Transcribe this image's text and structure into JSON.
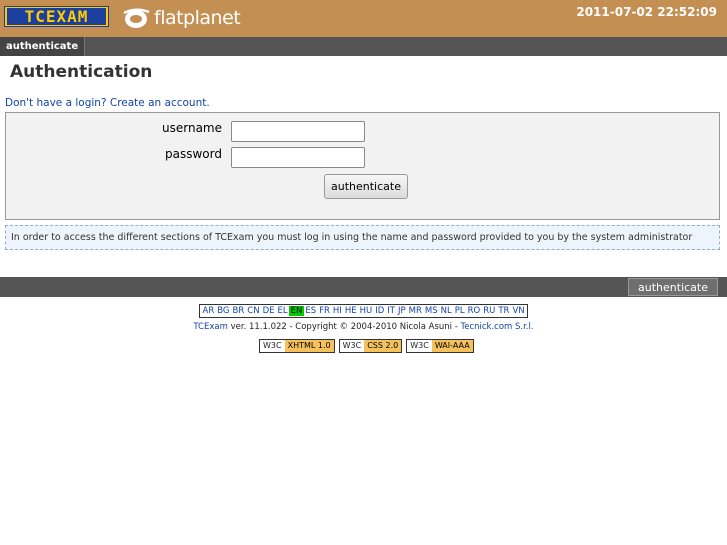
{
  "header": {
    "logo_tcexam": "TCEXAM",
    "logo_flatplanet": "flatplanet",
    "datetime": "2011-07-02 22:52:09"
  },
  "menu": {
    "tab_label": "authenticate"
  },
  "page": {
    "title": "Authentication",
    "create_account_link": "Don't have a login? Create an account."
  },
  "form": {
    "username_label": "username",
    "username_value": "",
    "password_label": "password",
    "password_value": "",
    "submit_label": "authenticate"
  },
  "info": {
    "message": "In order to access the different sections of TCExam you must log in using the name and password provided to you by the system administrator"
  },
  "bottombar": {
    "button_label": "authenticate"
  },
  "languages": {
    "items": [
      "AR",
      "BG",
      "BR",
      "CN",
      "DE",
      "EL",
      "EN",
      "ES",
      "FR",
      "HI",
      "HE",
      "HU",
      "ID",
      "IT",
      "JP",
      "MR",
      "MS",
      "NL",
      "PL",
      "RO",
      "RU",
      "TR",
      "VN"
    ],
    "active": "EN"
  },
  "credits": {
    "app_link": "TCExam",
    "version_text": " ver. 11.1.022 - Copyright © 2004-2010 Nicola Asuni - ",
    "company_link": "Tecnick.com S.r.l."
  },
  "badges": [
    {
      "prefix": "W3C",
      "label": "XHTML 1.0"
    },
    {
      "prefix": "W3C",
      "label": "CSS 2.0"
    },
    {
      "prefix": "W3C",
      "label": "WAI-AAA"
    }
  ],
  "colors": {
    "header_bg": "#c48f53",
    "bar_bg": "#555555",
    "link": "#1144aa",
    "active_language": "#00cc00",
    "badge_accent": "#f5c15b"
  }
}
